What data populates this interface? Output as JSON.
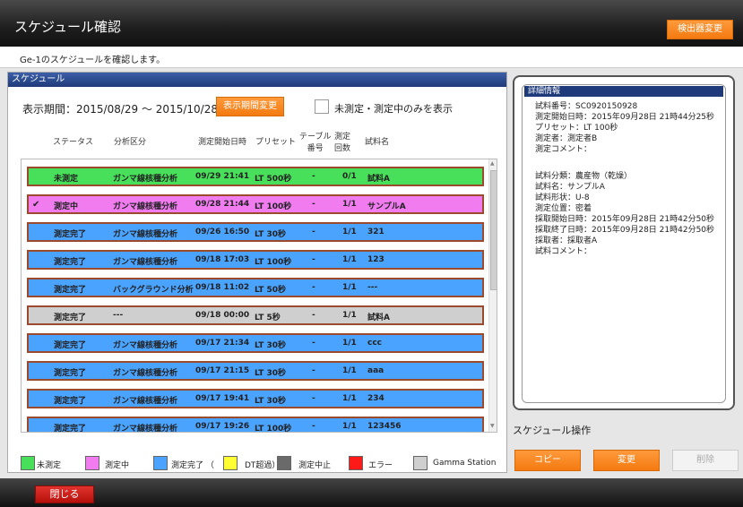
{
  "window": {
    "title": "スケジュール確認",
    "detector_change_label": "検出器変更",
    "subtitle": "Ge-1のスケジュールを確認します。"
  },
  "schedule": {
    "header": "スケジュール",
    "period_label": "表示期間：2015/08/29 ～ 2015/10/28",
    "period_change_label": "表示期間変更",
    "filter_label": "未測定・測定中のみを表示",
    "filter_checked": false,
    "columns": [
      "ステータス",
      "分析区分",
      "測定開始日時",
      "プリセット",
      "テーブル\n番号",
      "測定\n回数",
      "試料名"
    ],
    "rows": [
      {
        "status": "未測定",
        "type": "ガンマ線核種分析",
        "start": "09/29 21:41",
        "preset": "LT 500秒",
        "table": "-",
        "count": "0/1",
        "sample": "試料A",
        "color": "#48e05a",
        "selected": false
      },
      {
        "status": "測定中",
        "type": "ガンマ線核種分析",
        "start": "09/28 21:44",
        "preset": "LT 100秒",
        "table": "-",
        "count": "1/1",
        "sample": "サンプルA",
        "color": "#f07cf0",
        "selected": true
      },
      {
        "status": "測定完了",
        "type": "ガンマ線核種分析",
        "start": "09/26 16:50",
        "preset": "LT 30秒",
        "table": "-",
        "count": "1/1",
        "sample": "321",
        "color": "#4aa3ff",
        "selected": false
      },
      {
        "status": "測定完了",
        "type": "ガンマ線核種分析",
        "start": "09/18 17:03",
        "preset": "LT 100秒",
        "table": "-",
        "count": "1/1",
        "sample": "123",
        "color": "#4aa3ff",
        "selected": false
      },
      {
        "status": "測定完了",
        "type": "バックグラウンド分析",
        "start": "09/18 11:02",
        "preset": "LT 50秒",
        "table": "-",
        "count": "1/1",
        "sample": "---",
        "color": "#4aa3ff",
        "selected": false
      },
      {
        "status": "測定完了",
        "type": "---",
        "start": "09/18 00:00",
        "preset": "LT 5秒",
        "table": "-",
        "count": "1/1",
        "sample": "試料A",
        "color": "#cfcfcf",
        "selected": false
      },
      {
        "status": "測定完了",
        "type": "ガンマ線核種分析",
        "start": "09/17 21:34",
        "preset": "LT 30秒",
        "table": "-",
        "count": "1/1",
        "sample": "ccc",
        "color": "#4aa3ff",
        "selected": false
      },
      {
        "status": "測定完了",
        "type": "ガンマ線核種分析",
        "start": "09/17 21:15",
        "preset": "LT 30秒",
        "table": "-",
        "count": "1/1",
        "sample": "aaa",
        "color": "#4aa3ff",
        "selected": false
      },
      {
        "status": "測定完了",
        "type": "ガンマ線核種分析",
        "start": "09/17 19:41",
        "preset": "LT 30秒",
        "table": "-",
        "count": "1/1",
        "sample": "234",
        "color": "#4aa3ff",
        "selected": false
      },
      {
        "status": "測定完了",
        "type": "ガンマ線核種分析",
        "start": "09/17 19:26",
        "preset": "LT 100秒",
        "table": "-",
        "count": "1/1",
        "sample": "123456",
        "color": "#4aa3ff",
        "selected": false
      }
    ]
  },
  "legend": [
    {
      "label": "未測定",
      "color": "#48e05a"
    },
    {
      "label": "測定中",
      "color": "#f07cf0"
    },
    {
      "label": "測定完了 （",
      "color": "#4aa3ff"
    },
    {
      "label": "DT超過）",
      "color": "#ffff33"
    },
    {
      "label": "測定中止",
      "color": "#6a6a6a"
    },
    {
      "label": "エラー",
      "color": "#ff1a1a"
    },
    {
      "label": "Gamma Station",
      "color": "#cfcfcf"
    }
  ],
  "details": {
    "header": "詳細情報",
    "lines": [
      "試料番号：SC0920150928",
      "測定開始日時：2015年09月28日 21時44分25秒",
      "プリセット：LT 100秒",
      "測定者：測定者B",
      "測定コメント：",
      "",
      "試料分類：農産物（乾燥）",
      "試料名：サンプルA",
      "試料形状：U-8",
      "測定位置：密着",
      "採取開始日時：2015年09月28日 21時42分50秒",
      "採取終了日時：2015年09月28日 21時42分50秒",
      "採取者：採取者A",
      "試料コメント："
    ]
  },
  "operations": {
    "label": "スケジュール操作",
    "copy_label": "コピー",
    "change_label": "変更",
    "delete_label": "削除"
  },
  "footer": {
    "close_label": "閉じる"
  }
}
